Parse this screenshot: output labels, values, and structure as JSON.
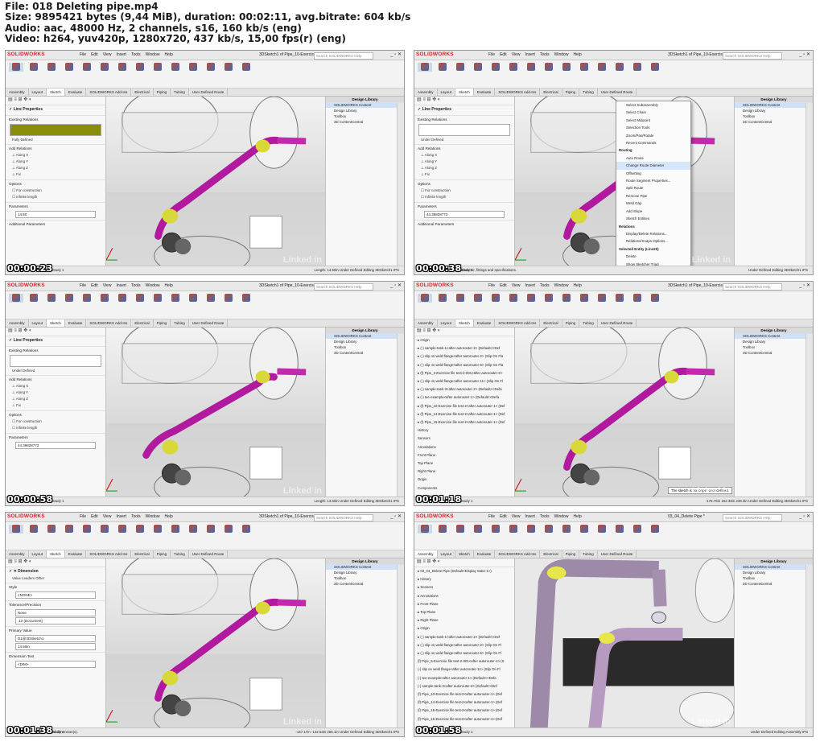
{
  "header": {
    "line1": "File: 018 Deleting pipe.mp4",
    "line2": "Size: 9895421 bytes (9,44 MiB), duration: 00:02:11, avg.bitrate: 604 kb/s",
    "line3": "Audio: aac, 48000 Hz, 2 channels, s16, 160 kb/s (eng)",
    "line4": "Video: h264, yuv420p, 1280x720, 437 kb/s, 15,00 fps(r) (eng)"
  },
  "app": {
    "logo": "SOLIDWORKS",
    "menus": [
      "File",
      "Edit",
      "View",
      "Insert",
      "Tools",
      "Window",
      "Help"
    ],
    "search_placeholder": "Search SOLIDWORKS Help",
    "window_controls": "_ ▫ ✕",
    "tabs_sketch": [
      "Assembly",
      "Layout",
      "Sketch",
      "Evaluate",
      "SOLIDWORKS Add-Ins",
      "Electrical",
      "Piping",
      "Tubing",
      "User Defined Route"
    ],
    "design_library_title": "Design Library",
    "design_library_items": [
      "SOLIDWORKS Content",
      "Design Library",
      "Toolbox",
      "3D ContentCentral"
    ],
    "bottom_tabs": [
      "Model",
      "Motion Study 1"
    ],
    "watermark": "Linked in"
  },
  "frames": [
    {
      "timecode": "00:00:23",
      "window_title": "3DSketch1 of Pipe_10-Exercise fil...",
      "panel_title": "Line Properties",
      "existing_relations": "Existing Relations",
      "status_line": "Fully Defined",
      "add_relations": "Add Relations",
      "relations": [
        "Along X",
        "Along Y",
        "Along Z",
        "Fix"
      ],
      "options": "Options",
      "option_items": [
        "For construction",
        "Infinite length"
      ],
      "parameters": "Parameters",
      "param_value": "14.50",
      "additional": "Additional Parameters",
      "status": [
        "Length: 14.50in",
        "Under Defined",
        "Editing 3DSketch1",
        "IPS"
      ]
    },
    {
      "timecode": "00:00:38",
      "window_title": "3DSketch1 of Pipe_10-Exercise fil...",
      "panel_title": "Line Properties",
      "existing_relations": "Existing Relations",
      "status_line": "Under Defined",
      "add_relations": "Add Relations",
      "relations": [
        "Along X",
        "Along Y",
        "Along Z",
        "Fix"
      ],
      "options": "Options",
      "option_items": [
        "For construction",
        "Infinite length"
      ],
      "parameters": "Parameters",
      "param_value": "44.39828773",
      "additional": "Additional Parameters",
      "status_hint": "ch as diameter, fittings and specifications.",
      "status": [
        "Under Defined",
        "Editing 3DSketch1",
        "IPS"
      ],
      "context_menu": {
        "top_items": [
          "Select Subassembly",
          "Select Chain",
          "Select Midpoint",
          "Selection Tools",
          "Zoom/Pan/Rotate",
          "Recent Commands"
        ],
        "routing_header": "Routing",
        "routing_items": [
          "Auto Route",
          "Change Route Diameter",
          "Offsetting",
          "Route Segment Properties...",
          "Split Route",
          "Remove Pipe",
          "Weld Gap",
          "Add Slope",
          "Sketch Entities"
        ],
        "relations_header": "Relations",
        "relations_items": [
          "Display/Delete Relations...",
          "Relations/Snaps Options..."
        ],
        "entity_header": "Selected Entity (Line29)",
        "entity_items": [
          "Delete",
          "Show Sketcher Triad",
          "Sketch Tools"
        ]
      }
    },
    {
      "timecode": "00:00:58",
      "window_title": "3DSketch1 of Pipe_10-Exercise fil...",
      "panel_title": "Line Properties",
      "existing_relations": "Existing Relations",
      "status_line": "Under Defined",
      "add_relations": "Add Relations",
      "relations": [
        "Along X",
        "Along Y",
        "Along Z",
        "Fix"
      ],
      "options": "Options",
      "option_items": [
        "For construction",
        "Infinite length"
      ],
      "parameters": "Parameters",
      "param_value": "44.39828773",
      "status": [
        "Length: 14.50in",
        "Under Defined",
        "Editing 3DSketch1",
        "IPS"
      ]
    },
    {
      "timecode": "00:01:18",
      "window_title": "3DSketch1 of Pipe_10-Exercise fil...",
      "tree": [
        "Origin",
        "(-) sample-tank-1<after autorouter-2> (Default<<Def",
        "(-) slip on weld flange<after autorouter-2> (Slip On Fla",
        "(-) slip on weld flange<after autorouter-6> (Slip On Fla",
        "(f) Pipe_2-Exercise file test-2-001<after autorouter-2>",
        "(-) slip on weld flange<after autorouter-11> (Slip On Fl",
        "(-) sample-tank-3<after autorouter-2> (Default<<Defa",
        "(-) tee-example<after autorouter-1> (Default<<Defa",
        "(f) Pipe_10-Exercise file test-2<after autorouter-1> (Def",
        "(f) Pipe_14-Exercise file test-2<after autorouter-1> (Def",
        "(f) Pipe_15-Exercise file test-2<after autorouter-1> (Def",
        "History",
        "Sensors",
        "Annotations",
        "Front Plane",
        "Top Plane",
        "Right Plane",
        "Origin",
        "Components",
        "Route Parts",
        "Mates",
        "Route1 ->",
        "(f) Pipe_16-Exercise file test-2<after autorouter-1> (Def"
      ],
      "tooltip": "The sketch is no longer over defined.",
      "status": [
        "-175.76in",
        "162.38in 239.3in",
        "Under Defined",
        "Editing 3DSketch1",
        "IPS"
      ]
    },
    {
      "timecode": "00:01:38",
      "window_title": "3DSketch1 of Pipe_10-Exercise fil...",
      "panel_title": "Dimension",
      "dim_tabs": [
        "Value",
        "Leaders",
        "Other"
      ],
      "style": "Style",
      "style_value": "<NONE>",
      "tolerance": "Tolerance/Precision",
      "tol_value": "None",
      "precision_value": ".12 (Document)",
      "primary": "Primary Value",
      "primary_field": "D1@3DSketch1",
      "primary_value": "14.50in",
      "dim_text": "Dimension Text",
      "dim_text_value": "<DIM>",
      "status_hint": "selected dimension(s).",
      "status": [
        "-147.17in",
        "-142.53in 256.1in",
        "Under Defined",
        "Editing 3DSketch1",
        "IPS"
      ]
    },
    {
      "timecode": "00:01:58",
      "window_title": "03_04_Delete Pipe *",
      "tabs": [
        "Assembly",
        "Layout",
        "Sketch",
        "Evaluate",
        "SOLIDWORKS Add-Ins",
        "Electrical",
        "Piping",
        "Tubing",
        "User Defined Route"
      ],
      "tree": [
        "03_04_Delete Pipe (Default<Display State-1>)",
        "History",
        "Sensors",
        "Annotations",
        "Front Plane",
        "Top Plane",
        "Right Plane",
        "Origin",
        "(-) sample-tank-1<after autorouter-2> (Default<<Def",
        "(-) slip on weld flange<after autorouter-2> (Slip On Fl",
        "(-) slip on weld flange<after autorouter-6> (Slip On Fl",
        "(f) Pipe_5-Exercise file test-2-001<after autorouter-1> (S",
        "(-) slip on weld flange<after autorouter-11> (Slip On Fl",
        "(-) tee-example<after autorouter-1> (Default<<Defa",
        "(-) sample-tank-3<after autorouter-2> (Default<<Def",
        "(f) Pipe_10-Exercise file test-2<after autorouter-1> (Def",
        "(f) Pipe_14-Exercise file test-2<after autorouter-1> (Def",
        "(f) Pipe_15-Exercise file test-2<after autorouter-1> (Def",
        "(f) Pipe_16-Exercise file test-2<after autorouter-1> (Def",
        "Mates",
        "LocalLPattern2"
      ],
      "status": [
        "Under Defined",
        "Editing Assembly",
        "IPS"
      ]
    }
  ]
}
